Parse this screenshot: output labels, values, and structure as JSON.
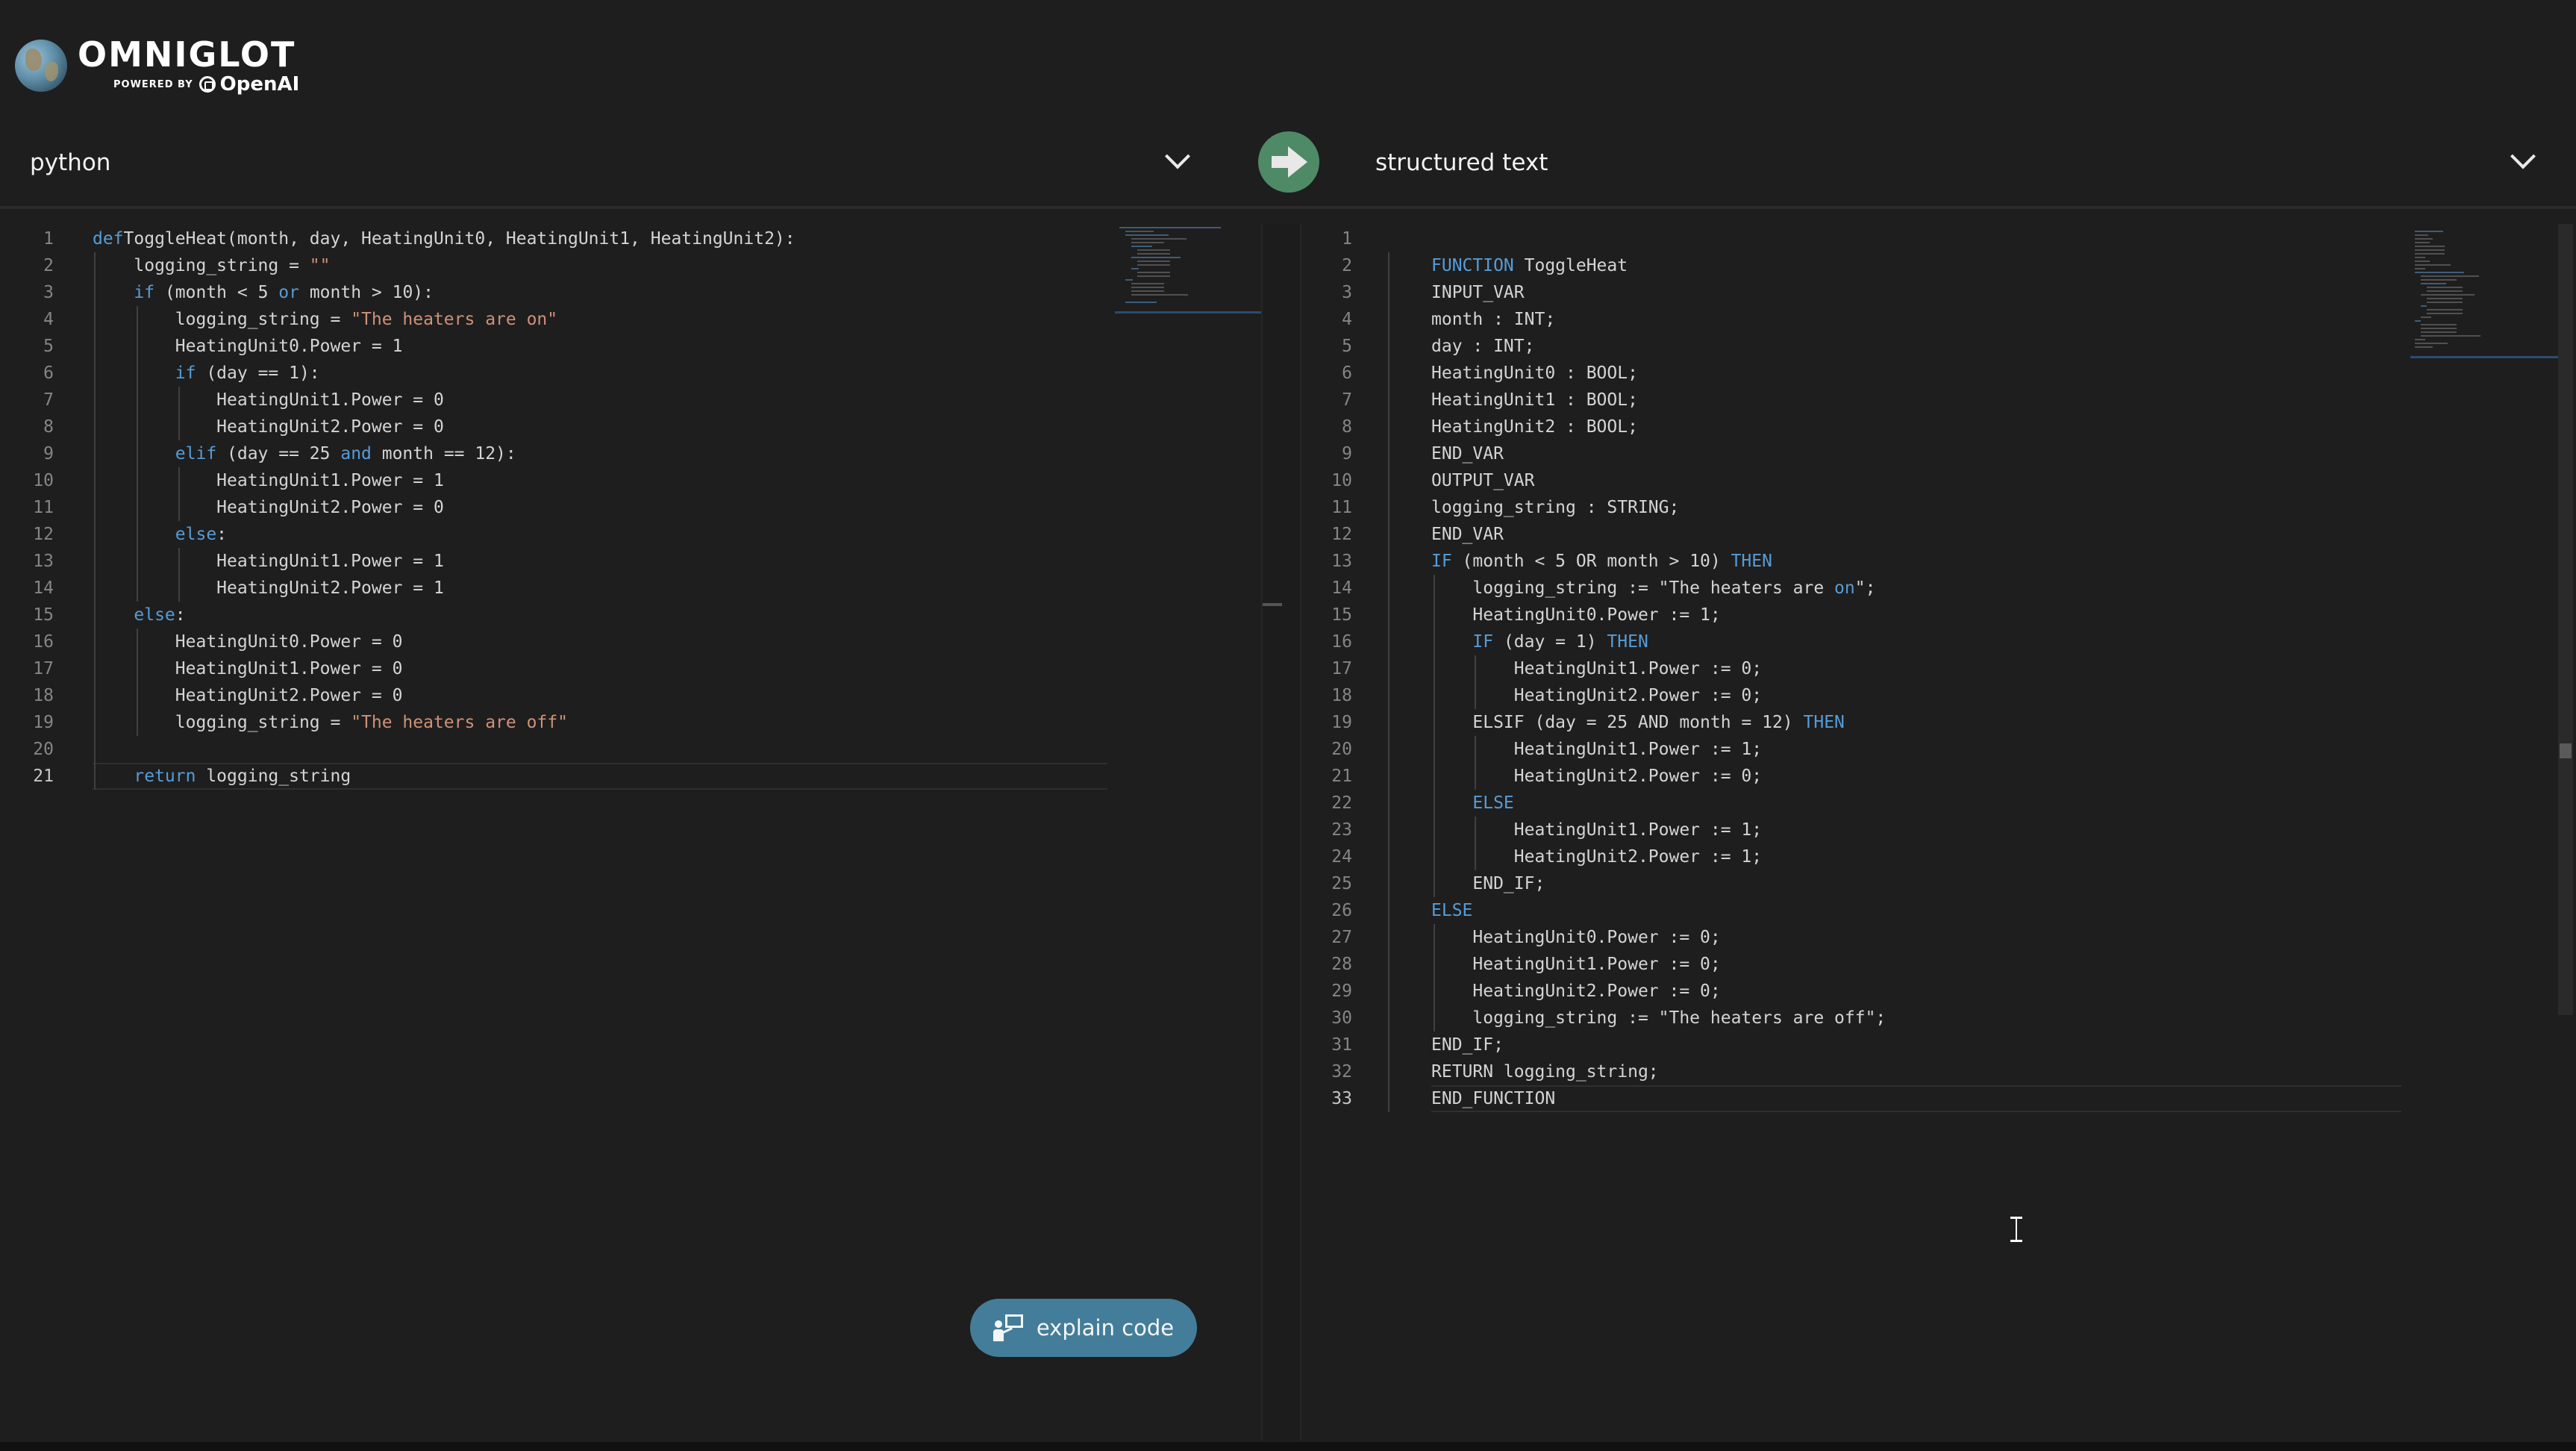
{
  "app": {
    "brand_name": "OMNIGLOT",
    "powered_by": "POWERED BY",
    "partner": "OpenAI"
  },
  "source": {
    "language": "python",
    "active_line": 21,
    "lines": [
      [
        [
          "kw",
          "def"
        ],
        [
          "",
          "ToggleHeat(month, day, HeatingUnit0, HeatingUnit1, HeatingUnit2):"
        ]
      ],
      [
        [
          "",
          "    logging_string = "
        ],
        [
          "str",
          "\"\""
        ]
      ],
      [
        [
          "kw",
          "    if"
        ],
        [
          "",
          " (month < 5 "
        ],
        [
          "kw",
          "or"
        ],
        [
          "",
          " month > 10):"
        ]
      ],
      [
        [
          "",
          "        logging_string = "
        ],
        [
          "str",
          "\"The heaters are on\""
        ]
      ],
      [
        [
          "",
          "        HeatingUnit0.Power = 1"
        ]
      ],
      [
        [
          "kw",
          "        if"
        ],
        [
          "",
          " (day == 1):"
        ]
      ],
      [
        [
          "",
          "            HeatingUnit1.Power = 0"
        ]
      ],
      [
        [
          "",
          "            HeatingUnit2.Power = 0"
        ]
      ],
      [
        [
          "kw",
          "        elif"
        ],
        [
          "",
          " (day == 25 "
        ],
        [
          "kw",
          "and"
        ],
        [
          "",
          " month == 12):"
        ]
      ],
      [
        [
          "",
          "            HeatingUnit1.Power = 1"
        ]
      ],
      [
        [
          "",
          "            HeatingUnit2.Power = 0"
        ]
      ],
      [
        [
          "kw",
          "        else"
        ],
        [
          "",
          ":"
        ]
      ],
      [
        [
          "",
          "            HeatingUnit1.Power = 1"
        ]
      ],
      [
        [
          "",
          "            HeatingUnit2.Power = 1"
        ]
      ],
      [
        [
          "kw",
          "    else"
        ],
        [
          "",
          ":"
        ]
      ],
      [
        [
          "",
          "        HeatingUnit0.Power = 0"
        ]
      ],
      [
        [
          "",
          "        HeatingUnit1.Power = 0"
        ]
      ],
      [
        [
          "",
          "        HeatingUnit2.Power = 0"
        ]
      ],
      [
        [
          "",
          "        logging_string = "
        ],
        [
          "str",
          "\"The heaters are off\""
        ]
      ],
      [
        [
          "",
          ""
        ]
      ],
      [
        [
          "kw",
          "    return"
        ],
        [
          "",
          " logging_string"
        ]
      ]
    ]
  },
  "target": {
    "language": "structured text",
    "active_line": 33,
    "lines": [
      [
        [
          "",
          ""
        ]
      ],
      [
        [
          "kw",
          "FUNCTION"
        ],
        [
          "",
          " ToggleHeat"
        ]
      ],
      [
        [
          "",
          "INPUT_VAR"
        ]
      ],
      [
        [
          "",
          "month : INT;"
        ]
      ],
      [
        [
          "",
          "day : INT;"
        ]
      ],
      [
        [
          "",
          "HeatingUnit0 : BOOL;"
        ]
      ],
      [
        [
          "",
          "HeatingUnit1 : BOOL;"
        ]
      ],
      [
        [
          "",
          "HeatingUnit2 : BOOL;"
        ]
      ],
      [
        [
          "",
          "END_VAR"
        ]
      ],
      [
        [
          "",
          "OUTPUT_VAR"
        ]
      ],
      [
        [
          "",
          "logging_string : STRING;"
        ]
      ],
      [
        [
          "",
          "END_VAR"
        ]
      ],
      [
        [
          "kw",
          "IF"
        ],
        [
          "",
          " (month < 5 OR month > 10) "
        ],
        [
          "kw",
          "THEN"
        ]
      ],
      [
        [
          "",
          "    logging_string := \"The heaters are "
        ],
        [
          "kw",
          "on"
        ],
        [
          "",
          "\";"
        ]
      ],
      [
        [
          "",
          "    HeatingUnit0.Power := 1;"
        ]
      ],
      [
        [
          "kw",
          "    IF"
        ],
        [
          "",
          " (day = 1) "
        ],
        [
          "kw",
          "THEN"
        ]
      ],
      [
        [
          "",
          "        HeatingUnit1.Power := 0;"
        ]
      ],
      [
        [
          "",
          "        HeatingUnit2.Power := 0;"
        ]
      ],
      [
        [
          "",
          "    ELSIF (day = 25 AND month = 12) "
        ],
        [
          "kw",
          "THEN"
        ]
      ],
      [
        [
          "",
          "        HeatingUnit1.Power := 1;"
        ]
      ],
      [
        [
          "",
          "        HeatingUnit2.Power := 0;"
        ]
      ],
      [
        [
          "kw",
          "    ELSE"
        ]
      ],
      [
        [
          "",
          "        HeatingUnit1.Power := 1;"
        ]
      ],
      [
        [
          "",
          "        HeatingUnit2.Power := 1;"
        ]
      ],
      [
        [
          "",
          "    END_IF;"
        ]
      ],
      [
        [
          "kw",
          "ELSE"
        ]
      ],
      [
        [
          "",
          "    HeatingUnit0.Power := 0;"
        ]
      ],
      [
        [
          "",
          "    HeatingUnit1.Power := 0;"
        ]
      ],
      [
        [
          "",
          "    HeatingUnit2.Power := 0;"
        ]
      ],
      [
        [
          "",
          "    logging_string := \"The heaters are off\";"
        ]
      ],
      [
        [
          "",
          "END_IF;"
        ]
      ],
      [
        [
          "",
          "RETURN logging_string;"
        ]
      ],
      [
        [
          "",
          "END_FUNCTION"
        ]
      ]
    ]
  },
  "actions": {
    "explain_label": "explain code"
  },
  "colors": {
    "keyword": "#569cd6",
    "string": "#ce9178",
    "convert_button": "#4e8a66",
    "explain_button": "#437d99"
  },
  "icons": {
    "convert": "arrow-right-icon",
    "explain": "presenter-icon",
    "dropdown": "chevron-down-icon",
    "cursor": "text-cursor-icon"
  }
}
